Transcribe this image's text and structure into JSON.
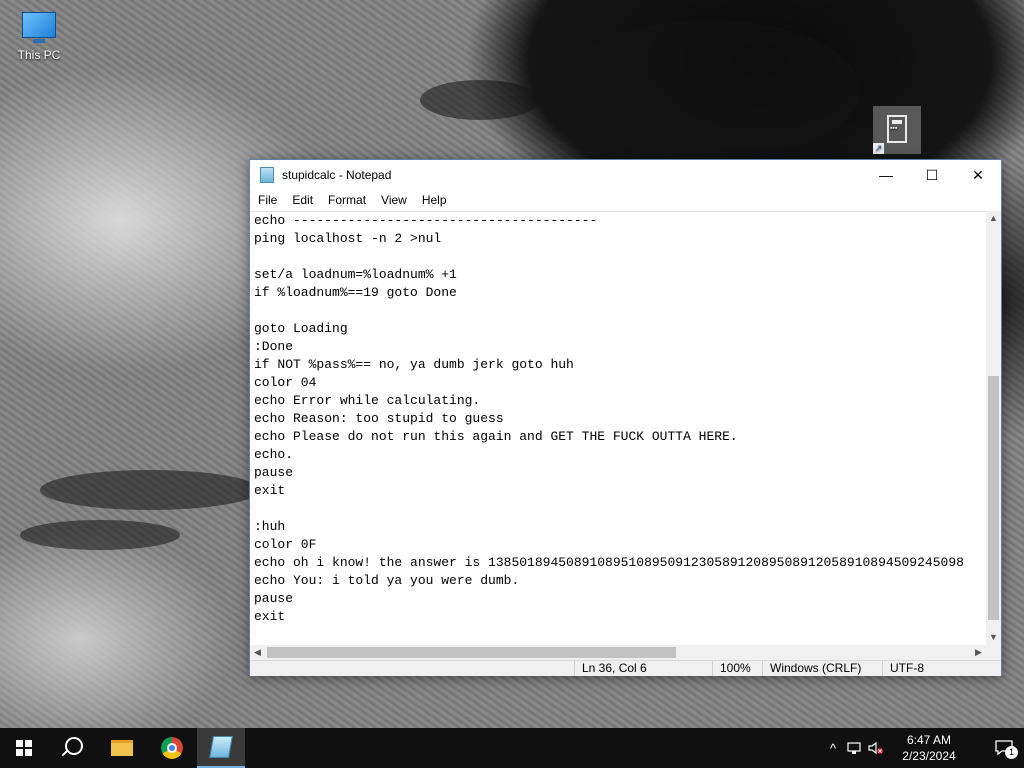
{
  "desktop": {
    "icons": [
      {
        "label": "This PC"
      }
    ]
  },
  "notepad": {
    "title": "stupidcalc - Notepad",
    "menu": [
      "File",
      "Edit",
      "Format",
      "View",
      "Help"
    ],
    "content_lines": [
      "echo ---------------------------------------",
      "ping localhost -n 2 >nul",
      "",
      "set/a loadnum=%loadnum% +1",
      "if %loadnum%==19 goto Done",
      "",
      "goto Loading",
      ":Done",
      "if NOT %pass%== no, ya dumb jerk goto huh",
      "color 04",
      "echo Error while calculating.",
      "echo Reason: too stupid to guess",
      "echo Please do not run this again and GET THE FUCK OUTTA HERE.",
      "echo.",
      "pause",
      "exit",
      "",
      ":huh",
      "color 0F",
      "echo oh i know! the answer is 1385018945089108951089509123058912089508912058910894509245098",
      "echo You: i told ya you were dumb.",
      "pause",
      "exit"
    ],
    "status": {
      "position": "Ln 36, Col 6",
      "zoom": "100%",
      "line_ending": "Windows (CRLF)",
      "encoding": "UTF-8"
    },
    "window_controls": {
      "minimize": "—",
      "maximize": "☐",
      "close": "✕"
    }
  },
  "taskbar": {
    "clock": {
      "time": "6:47 AM",
      "date": "2/23/2024"
    },
    "notification_count": "1",
    "tray_chevron": "^"
  }
}
